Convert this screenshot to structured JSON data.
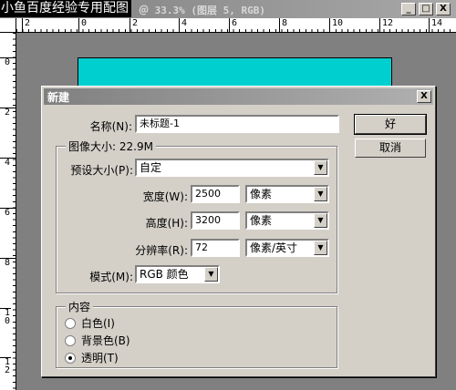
{
  "document_window": {
    "title": "＠ 33.3% (图层 5, RGB)",
    "watermark": "小鱼百度经验专用配图",
    "controls": {
      "minimize": "_",
      "maximize": "□",
      "close": "X"
    },
    "ruler_h": [
      "2",
      "0",
      "2",
      "4",
      "6",
      "8",
      "10",
      "12",
      "14"
    ],
    "ruler_v": [
      "0",
      "2",
      "4",
      "6",
      "8",
      "1 0",
      "1 2"
    ]
  },
  "dialog": {
    "title": "新建",
    "close": "X",
    "name_label": "名称(N):",
    "name_value": "未标题-1",
    "ok_label": "好",
    "cancel_label": "取消",
    "image_size_group": "图像大小: 22.9M",
    "preset_label": "预设大小(P):",
    "preset_value": "自定",
    "width_label": "宽度(W):",
    "width_value": "2500",
    "width_unit": "像素",
    "height_label": "高度(H):",
    "height_value": "3200",
    "height_unit": "像素",
    "resolution_label": "分辨率(R):",
    "resolution_value": "72",
    "resolution_unit": "像素/英寸",
    "mode_label": "模式(M):",
    "mode_value": "RGB 颜色",
    "contents_group": "内容",
    "contents_options": [
      {
        "label": "白色(I)",
        "selected": false
      },
      {
        "label": "背景色(B)",
        "selected": false
      },
      {
        "label": "透明(T)",
        "selected": true
      }
    ]
  }
}
